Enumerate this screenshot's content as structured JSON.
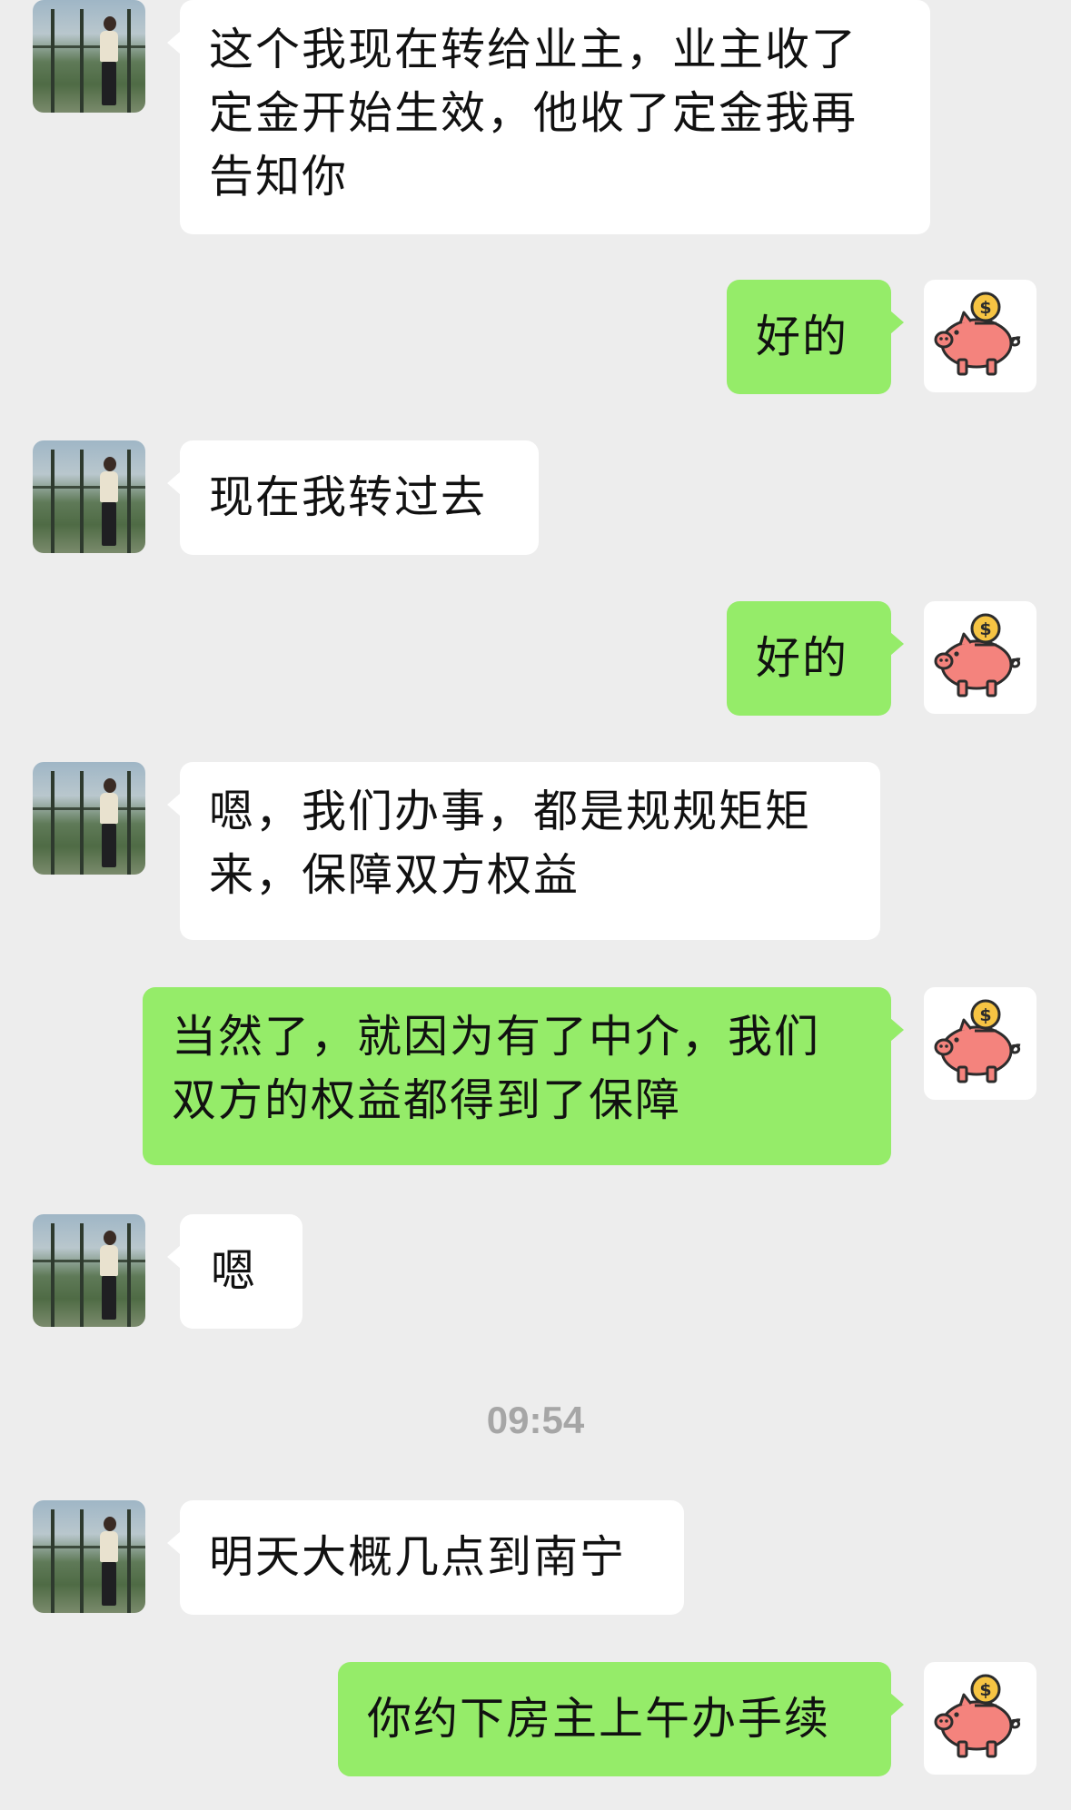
{
  "chat": {
    "messages": [
      {
        "side": "in",
        "text": "这个我现在转给业主，业主收了定金开始生效，他收了定金我再告知你"
      },
      {
        "side": "out",
        "text": "好的"
      },
      {
        "side": "in",
        "text": "现在我转过去"
      },
      {
        "side": "out",
        "text": "好的"
      },
      {
        "side": "in",
        "text": "嗯，我们办事，都是规规矩矩来，保障双方权益"
      },
      {
        "side": "out",
        "text": "当然了，就因为有了中介，我们双方的权益都得到了保障"
      },
      {
        "side": "in",
        "text": "嗯"
      },
      {
        "side": "out",
        "text": "你约下房主上午办手续"
      }
    ],
    "timestamp": "09:54",
    "in_avatar_icon": "person-photo",
    "out_avatar_icon": "piggy-bank-icon",
    "colors": {
      "background": "#ededed",
      "incoming": "#ffffff",
      "outgoing": "#95ec69",
      "piggy": "#f4837d",
      "coin": "#f6c443"
    }
  }
}
